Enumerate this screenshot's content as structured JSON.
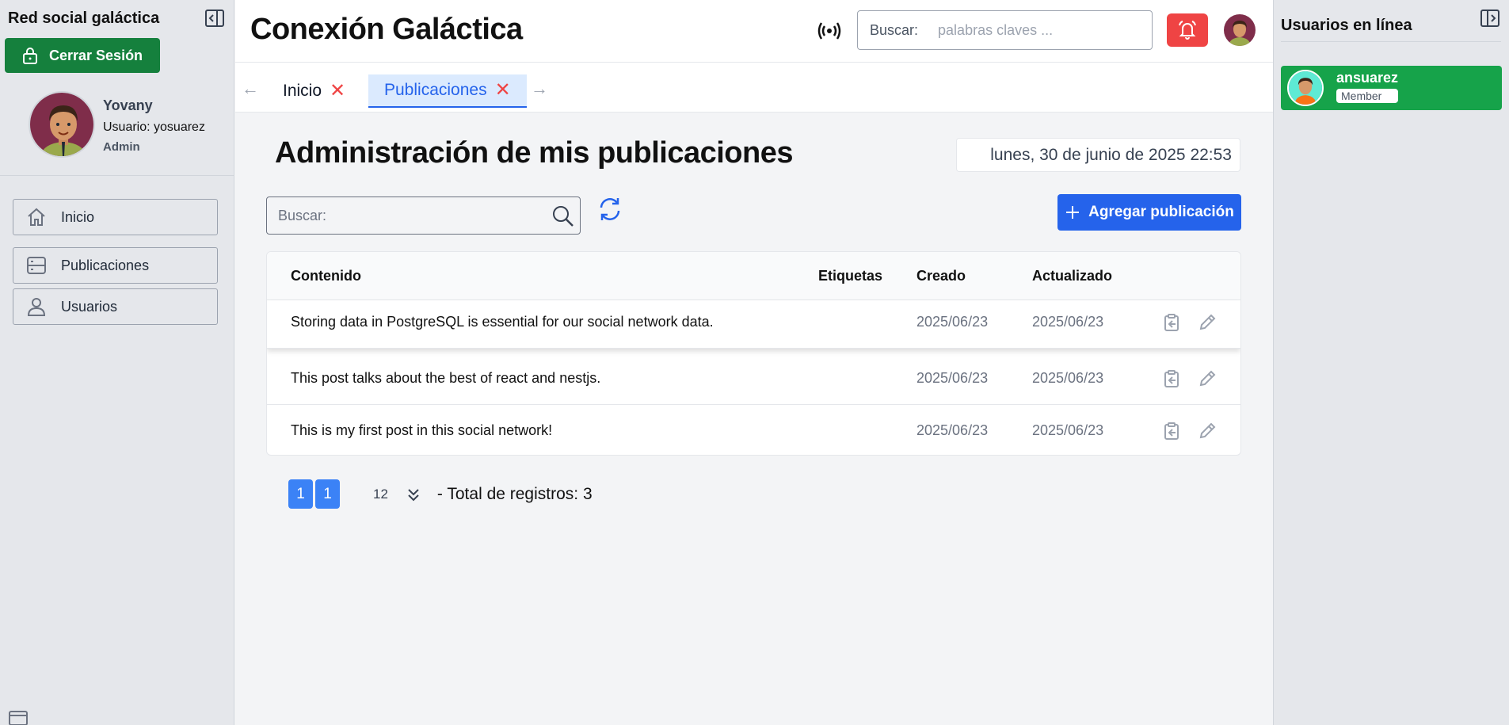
{
  "left_sidebar": {
    "brand": "Red social galáctica",
    "logout_label": "Cerrar Sesión",
    "profile": {
      "name": "Yovany",
      "username": "Usuario: yosuarez",
      "role": "Admin"
    },
    "nav": [
      {
        "label": "Inicio",
        "icon": "home-icon"
      },
      {
        "label": "Publicaciones",
        "icon": "server-icon"
      },
      {
        "label": "Usuarios",
        "icon": "user-icon"
      }
    ]
  },
  "header": {
    "title": "Conexión Galáctica",
    "search_label": "Buscar:",
    "search_placeholder": "palabras claves ...",
    "alarm_color": "#ef4444"
  },
  "tabs": [
    {
      "label": "Inicio",
      "active": false
    },
    {
      "label": "Publicaciones",
      "active": true
    }
  ],
  "main": {
    "page_title": "Administración de mis publicaciones",
    "datetime": "lunes, 30 de junio de 2025 22:53",
    "search_label": "Buscar:",
    "add_button": "Agregar publicación",
    "table": {
      "columns": [
        "Contenido",
        "Etiquetas",
        "Creado",
        "Actualizado"
      ],
      "rows": [
        {
          "content": "Storing data in PostgreSQL is essential for our social network data.",
          "tags": "",
          "created": "2025/06/23",
          "updated": "2025/06/23"
        },
        {
          "content": "This post talks about the best of react and nestjs.",
          "tags": "",
          "created": "2025/06/23",
          "updated": "2025/06/23"
        },
        {
          "content": "This is my first post in this social network!",
          "tags": "",
          "created": "2025/06/23",
          "updated": "2025/06/23"
        }
      ]
    },
    "pagination": {
      "page_a": "1",
      "page_b": "1",
      "per_page": "12",
      "total": "- Total de registros: 3"
    }
  },
  "right_sidebar": {
    "title": "Usuarios en línea",
    "users": [
      {
        "name": "ansuarez",
        "role": "Member"
      }
    ]
  },
  "colors": {
    "primary": "#2563eb",
    "success": "#15803d",
    "danger": "#ef4444"
  }
}
